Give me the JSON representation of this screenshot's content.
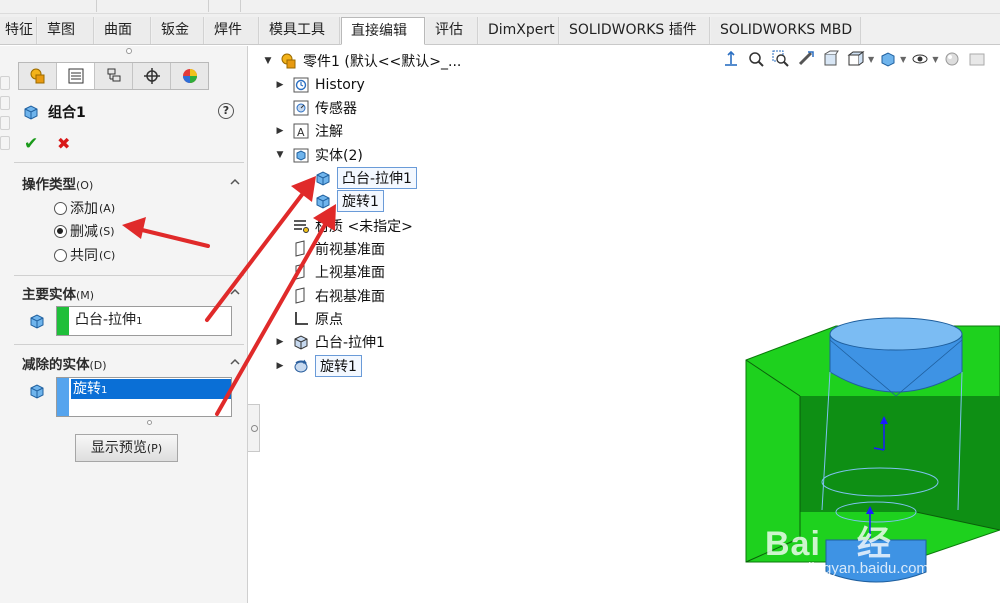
{
  "command_tabs": [
    {
      "label": "特征",
      "active": false
    },
    {
      "label": "草图",
      "active": false
    },
    {
      "label": "曲面",
      "active": false
    },
    {
      "label": "钣金",
      "active": false
    },
    {
      "label": "焊件",
      "active": false
    },
    {
      "label": "模具工具",
      "active": false
    },
    {
      "label": "直接编辑",
      "active": true
    },
    {
      "label": "评估",
      "active": false
    },
    {
      "label": "DimXpert",
      "active": false
    },
    {
      "label": "SOLIDWORKS 插件",
      "active": false
    },
    {
      "label": "SOLIDWORKS MBD",
      "active": false
    }
  ],
  "property_manager": {
    "title": "组合1",
    "help": "?",
    "ok": "✔",
    "cancel": "✖",
    "operation_type": {
      "header": "操作类型",
      "accel": "(O)",
      "options": [
        {
          "label": "添加",
          "accel": "(A)",
          "selected": false
        },
        {
          "label": "删减",
          "accel": "(S)",
          "selected": true
        },
        {
          "label": "共同",
          "accel": "(C)",
          "selected": false
        }
      ]
    },
    "main_body": {
      "header": "主要实体",
      "accel": "(M)",
      "item": "凸台-拉伸",
      "item_sub": "1",
      "bar_color": "#1fbf3a"
    },
    "subtract_bodies": {
      "header": "减除的实体",
      "accel": "(D)",
      "item": "旋转",
      "item_sub": "1",
      "bar_color": "#55a4ee"
    },
    "preview_button": "显示预览",
    "preview_accel": "(P)"
  },
  "feature_tree": {
    "root": "零件1  (默认<<默认>_...",
    "items": [
      {
        "label": "History",
        "icon": "history-icon",
        "expander": "▶"
      },
      {
        "label": "传感器",
        "icon": "sensor-icon",
        "expander": ""
      },
      {
        "label": "注解",
        "icon": "annotation-icon",
        "expander": "▶"
      },
      {
        "label": "实体(2)",
        "icon": "solid-bodies-icon",
        "expander": "▼"
      },
      {
        "label": "凸台-拉伸1",
        "icon": "body-icon",
        "expander": ""
      },
      {
        "label": "旋转1",
        "icon": "body-icon",
        "expander": ""
      },
      {
        "label": "材质 <未指定>",
        "icon": "material-icon",
        "expander": ""
      },
      {
        "label": "前视基准面",
        "icon": "plane-icon",
        "expander": ""
      },
      {
        "label": "上视基准面",
        "icon": "plane-icon",
        "expander": ""
      },
      {
        "label": "右视基准面",
        "icon": "plane-icon",
        "expander": ""
      },
      {
        "label": "原点",
        "icon": "origin-icon",
        "expander": ""
      },
      {
        "label": "凸台-拉伸1",
        "icon": "extrude-icon",
        "expander": "▶"
      },
      {
        "label": "旋转1",
        "icon": "revolve-icon",
        "expander": "▶"
      }
    ]
  },
  "watermark": {
    "big": "Bai",
    "big2": "经",
    "small": "jingyan.baidu.com"
  },
  "colors": {
    "accent_selection": "#0a6fd6",
    "arrow_red": "#e02a2a",
    "model_green": "#1fd21f",
    "model_blue": "#4a9be8"
  }
}
